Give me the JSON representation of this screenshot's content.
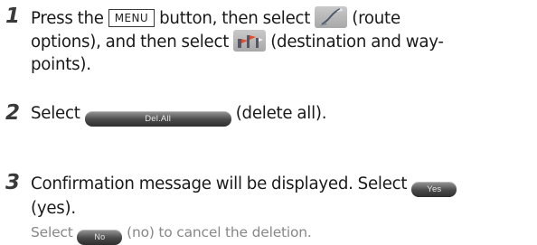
{
  "steps": [
    {
      "number": "1",
      "line1_part1": "Press the",
      "menu_key": "MENU",
      "line1_part2": "button, then select",
      "line1_part3": "(route",
      "line2_part1": "options), and then select",
      "line2_part2": "(destination and way-",
      "line3": "points)."
    },
    {
      "number": "2",
      "part1": "Select",
      "button_label": "Del.All",
      "part2": "(delete all)."
    },
    {
      "number": "3",
      "line1": "Confirmation message will be displayed. Select",
      "yes_label": "Yes",
      "line2": "(yes)."
    }
  ],
  "note": {
    "part1": "Select",
    "no_label": "No",
    "part2": "(no) to cancel the deletion."
  },
  "icons": {
    "route_options": "route-options-icon",
    "destination_waypoints": "destination-waypoints-icon"
  }
}
